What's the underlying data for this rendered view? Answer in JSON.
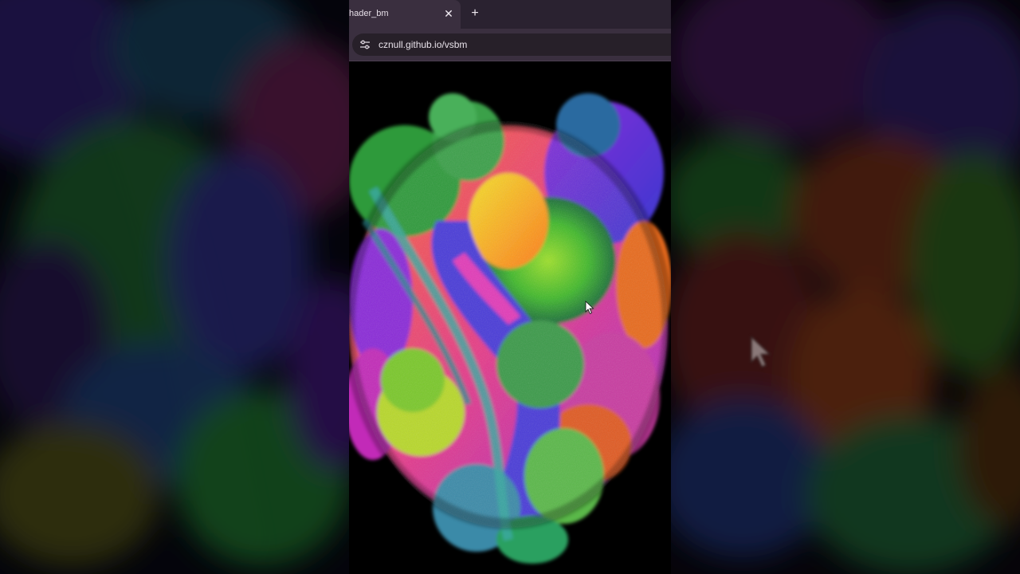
{
  "browser": {
    "tab": {
      "title": "hader_bm",
      "close_glyph": "✕"
    },
    "new_tab_glyph": "+",
    "address_bar": {
      "url": "cznull.github.io/vsbm",
      "site_info_icon": "tune-icon"
    }
  },
  "page": {
    "content": "fractal-render",
    "background": "#000000"
  },
  "colors": {
    "tab_strip": "#2a2230",
    "active_tab": "#3a2f3f",
    "omnibox": "#272029",
    "text": "#e9e3eb"
  },
  "icons": {
    "tab_close": "close-icon",
    "new_tab": "plus-icon",
    "cursor": "mouse-pointer-icon"
  }
}
